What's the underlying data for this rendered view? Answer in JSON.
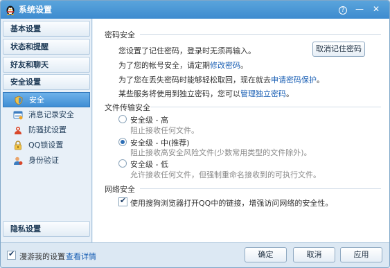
{
  "window": {
    "title": "系统设置"
  },
  "titlebar": {
    "help_icon": "?",
    "minimize_icon": "—",
    "close_icon": "✕"
  },
  "sidebar": {
    "groups": [
      {
        "label": "基本设置"
      },
      {
        "label": "状态和提醒"
      },
      {
        "label": "好友和聊天"
      },
      {
        "label": "安全设置"
      }
    ],
    "items": [
      {
        "label": "安全",
        "icon": "shield-icon"
      },
      {
        "label": "消息记录安全",
        "icon": "message-record-icon"
      },
      {
        "label": "防骚扰设置",
        "icon": "anti-harassment-icon"
      },
      {
        "label": "QQ锁设置",
        "icon": "lock-icon"
      },
      {
        "label": "身份验证",
        "icon": "identity-icon"
      }
    ],
    "privacy": {
      "label": "隐私设置"
    }
  },
  "password_section": {
    "title": "密码安全",
    "line1": "您设置了记住密码，登录时无须再输入。",
    "cancel_button": "取消记住密码",
    "line2_prefix": "为了您的帐号安全，请定期",
    "line2_link": "修改密码",
    "line2_suffix": "。",
    "line3_prefix": "为了您在丢失密码时能够轻松取回，现在就去",
    "line3_link": "申请密码保护",
    "line3_suffix": "。",
    "line4_prefix": "某些服务将使用到独立密码，您可以",
    "line4_link": "管理独立密码",
    "line4_suffix": "。"
  },
  "file_section": {
    "title": "文件传输安全",
    "options": [
      {
        "label": "安全级 - 高",
        "desc": "阻止接收任何文件。",
        "selected": false
      },
      {
        "label": "安全级 - 中(推荐)",
        "desc": "阻止接收高安全风险文件(少数常用类型的文件除外)。",
        "selected": true
      },
      {
        "label": "安全级 - 低",
        "desc": "允许接收任何文件，但强制重命名接收到的可执行文件。",
        "selected": false
      }
    ]
  },
  "network_section": {
    "title": "网络安全",
    "checkbox_label": "使用搜狗浏览器打开QQ中的链接，增强访问网络的安全性。",
    "checked": true
  },
  "footer": {
    "roam_label": "漫游我的设置",
    "roam_checked": true,
    "details_link": "查看详情",
    "ok_button": "确定",
    "cancel_button": "取消",
    "apply_button": "应用"
  },
  "colors": {
    "accent": "#3f8ed4",
    "link": "#1a5fb4",
    "titlebar": "#4a97d6"
  }
}
